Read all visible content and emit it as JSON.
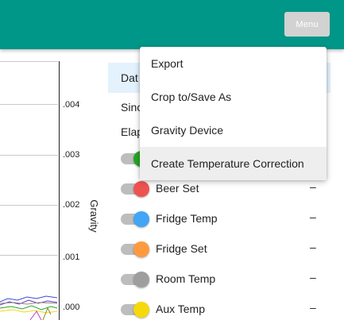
{
  "menu_button": {
    "label": "Menu"
  },
  "chart": {
    "ylabel": "Gravity",
    "y_ticks": [
      ".004",
      ".003",
      ".002",
      ".001",
      ".000"
    ]
  },
  "panel": {
    "header_label": "Dat",
    "since_label": "Sinc",
    "elapsed_label": "Elap"
  },
  "series": [
    {
      "name": "",
      "value": "",
      "color": "#22a722"
    },
    {
      "name": "Beer Set",
      "value": "–",
      "color": "#ef5350"
    },
    {
      "name": "Fridge Temp",
      "value": "–",
      "color": "#42a5f5"
    },
    {
      "name": "Fridge Set",
      "value": "–",
      "color": "#ff9a40"
    },
    {
      "name": "Room Temp",
      "value": "–",
      "color": "#9e9e9e"
    },
    {
      "name": "Aux Temp",
      "value": "–",
      "color": "#f5d90a"
    }
  ],
  "dropdown_menu": {
    "items": [
      {
        "label": "Export"
      },
      {
        "label": "Crop to/Save As"
      },
      {
        "label": "Gravity Device"
      },
      {
        "label": "Create Temperature Correction",
        "highlighted": true
      }
    ]
  }
}
